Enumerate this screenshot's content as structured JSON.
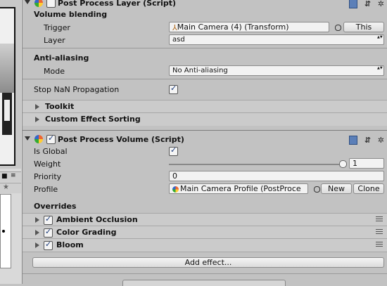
{
  "post_process_layer": {
    "title": "Post Process Layer (Script)",
    "enabled": false,
    "volume_blending_label": "Volume blending",
    "trigger_label": "Trigger",
    "trigger_value": "Main Camera (4) (Transform)",
    "this_button": "This",
    "layer_label": "Layer",
    "layer_value": "asd",
    "anti_aliasing_label": "Anti-aliasing",
    "mode_label": "Mode",
    "mode_value": "No Anti-aliasing",
    "stop_nan_label": "Stop NaN Propagation",
    "stop_nan_checked": true,
    "toolkit_label": "Toolkit",
    "custom_effect_sorting_label": "Custom Effect Sorting"
  },
  "post_process_volume": {
    "title": "Post Process Volume (Script)",
    "enabled": true,
    "is_global_label": "Is Global",
    "is_global_checked": true,
    "weight_label": "Weight",
    "weight_value": "1",
    "weight_fraction": 1,
    "priority_label": "Priority",
    "priority_value": "0",
    "profile_label": "Profile",
    "profile_value": "Main Camera Profile (PostProce",
    "new_button": "New",
    "clone_button": "Clone",
    "overrides_label": "Overrides",
    "effects": [
      {
        "label": "Ambient Occlusion",
        "enabled": true
      },
      {
        "label": "Color Grading",
        "enabled": true
      },
      {
        "label": "Bloom",
        "enabled": true
      }
    ],
    "add_effect_button": "Add effect..."
  },
  "icons": [
    "book-icon",
    "settings-sliders-icon",
    "gear-icon",
    "color-script-icon",
    "menu-icon",
    "star-icon",
    "lock-icon"
  ],
  "colors": {
    "inspector_bg": "#c2c2c2",
    "field_bg": "#f2f2f2",
    "check_color": "#1a3a7a"
  }
}
